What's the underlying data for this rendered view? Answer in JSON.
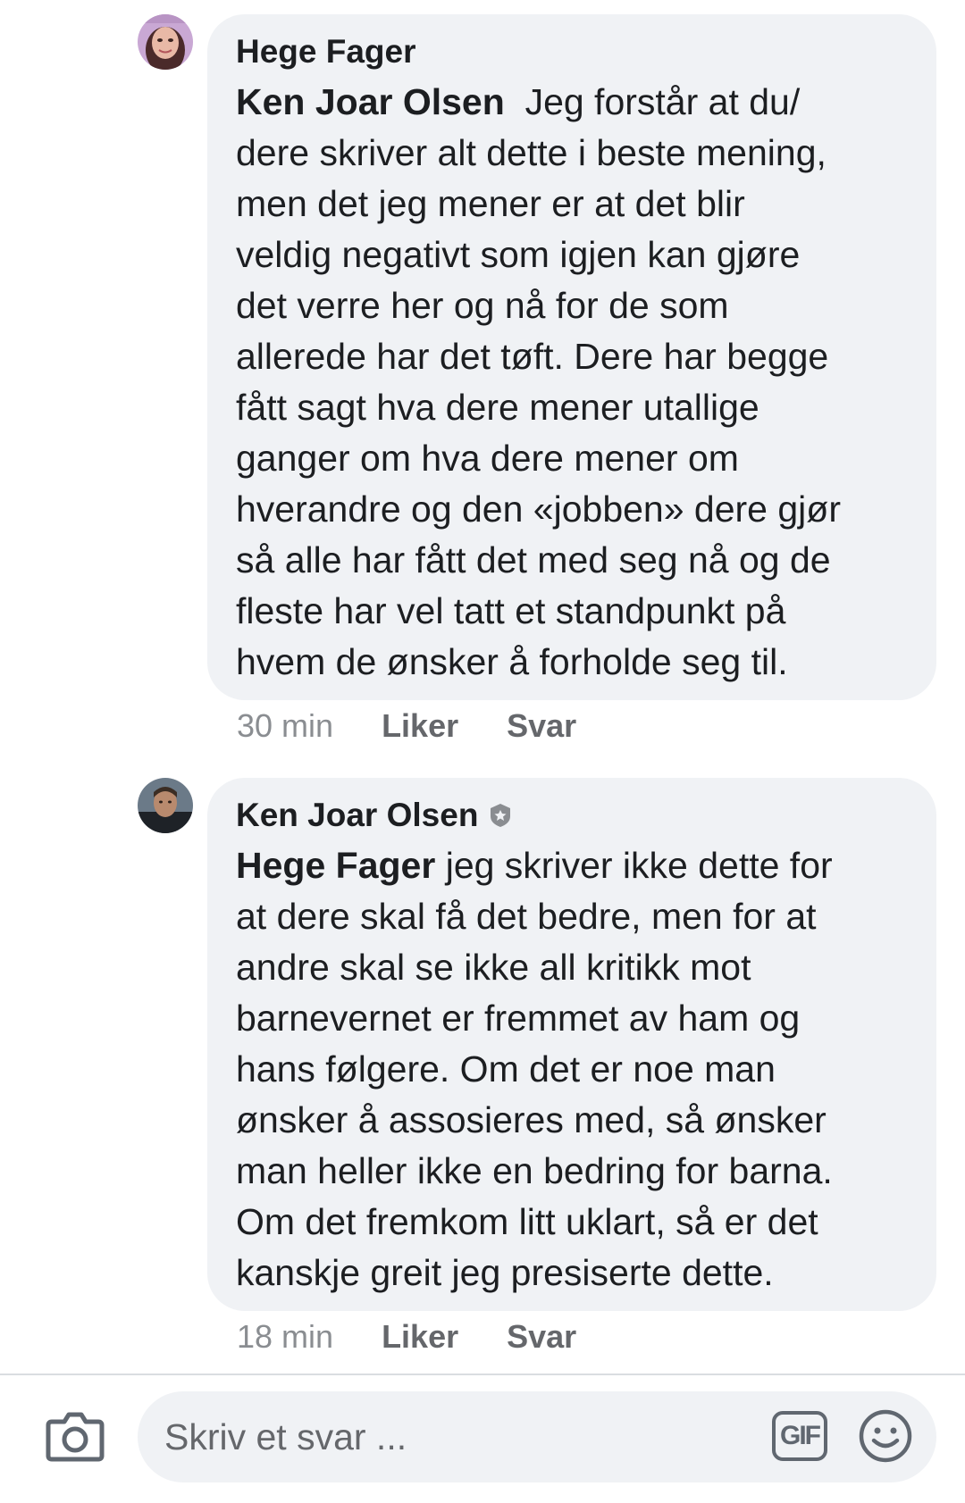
{
  "comments": [
    {
      "author": "Hege Fager",
      "verified": false,
      "mention": "Ken Joar Olsen",
      "text": "  Jeg forstår at du/\ndere skriver alt dette i beste mening,\nmen det jeg mener er at det blir\nveldig negativt som igjen kan gjøre\ndet verre her og nå for de som\nallerede har det tøft. Dere har begge\nfått sagt hva dere mener utallige\nganger om hva dere mener om\nhverandre og den «jobben» dere gjør\nså alle har fått det med seg nå og de\nfleste har vel tatt et standpunkt på\nhvem de ønsker å forholde seg til.",
      "time": "30 min",
      "like_label": "Liker",
      "reply_label": "Svar"
    },
    {
      "author": "Ken Joar Olsen",
      "verified": true,
      "mention": "Hege Fager",
      "text": " jeg skriver ikke dette for\nat dere skal få det bedre, men for at\nandre skal se ikke all kritikk mot\nbarnevernet er fremmet av ham og\nhans følgere. Om det er noe man\nønsker å assosieres med, så ønsker\nman heller ikke en bedring for barna.\nOm det fremkom litt uklart, så er det\nkanskje greit jeg presiserte dette.",
      "time": "18 min",
      "like_label": "Liker",
      "reply_label": "Svar"
    }
  ],
  "composer": {
    "placeholder": "Skriv et svar ...",
    "gif_label": "GIF",
    "icons": [
      "camera-icon",
      "gif-icon",
      "smiley-icon"
    ]
  },
  "colors": {
    "bubble": "#f0f2f5",
    "meta": "#65676b",
    "text": "#1c1e21"
  }
}
